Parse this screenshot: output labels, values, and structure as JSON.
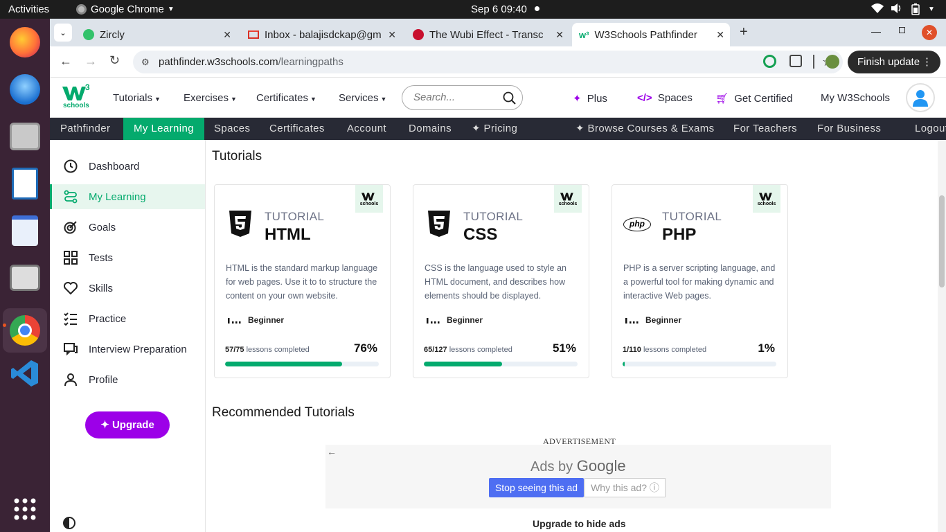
{
  "system": {
    "activities": "Activities",
    "app": "Google Chrome",
    "datetime": "Sep 6  09:40"
  },
  "browser": {
    "tabs": [
      {
        "title": "Zircly"
      },
      {
        "title": "Inbox - balajisdckap@gm"
      },
      {
        "title": "The Wubi Effect - Transc"
      },
      {
        "title": "W3Schools Pathfinder"
      }
    ],
    "url_host": "pathfinder.w3schools.com",
    "url_path": "/learningpaths",
    "finish_update": "Finish update"
  },
  "w3nav": {
    "logo_sup": "3",
    "logo_text": "schools",
    "tutorials": "Tutorials",
    "exercises": "Exercises",
    "certificates": "Certificates",
    "services": "Services",
    "search_placeholder": "Search...",
    "plus": "Plus",
    "spaces": "Spaces",
    "get_certified": "Get Certified",
    "my_w3schools": "My W3Schools"
  },
  "subnav": [
    "Pathfinder",
    "My Learning",
    "Spaces",
    "Certificates",
    "Account",
    "Domains",
    "Pricing",
    "Browse Courses & Exams",
    "For Teachers",
    "For Business",
    "Logout"
  ],
  "sidebar": {
    "items": [
      {
        "label": "Dashboard",
        "icon": "clock-icon"
      },
      {
        "label": "My Learning",
        "icon": "path-icon"
      },
      {
        "label": "Goals",
        "icon": "target-icon"
      },
      {
        "label": "Tests",
        "icon": "grid-icon"
      },
      {
        "label": "Skills",
        "icon": "heart-icon"
      },
      {
        "label": "Practice",
        "icon": "checklist-icon"
      },
      {
        "label": "Interview Preparation",
        "icon": "chat-icon"
      },
      {
        "label": "Profile",
        "icon": "person-icon"
      }
    ],
    "upgrade": "Upgrade"
  },
  "main": {
    "tutorials_heading": "Tutorials",
    "cards": [
      {
        "kind": "TUTORIAL",
        "name": "HTML",
        "desc": "HTML is the standard markup language for web pages. Use it to to structure the content on your own website.",
        "level": "Beginner",
        "done": "57/75",
        "lessons_text": "lessons completed",
        "percent": "76%",
        "progress": 0.76
      },
      {
        "kind": "TUTORIAL",
        "name": "CSS",
        "desc": "CSS is the language used to style an HTML document, and describes how elements should be displayed.",
        "level": "Beginner",
        "done": "65/127",
        "lessons_text": "lessons completed",
        "percent": "51%",
        "progress": 0.51
      },
      {
        "kind": "TUTORIAL",
        "name": "PHP",
        "desc": "PHP is a server scripting language, and a powerful tool for making dynamic and interactive Web pages.",
        "level": "Beginner",
        "done": "1/110",
        "lessons_text": "lessons completed",
        "percent": "1%",
        "progress": 0.01
      }
    ],
    "recommended_heading": "Recommended Tutorials",
    "ad_label": "ADVERTISEMENT",
    "ads_by": "Ads by",
    "ads_google": "Google",
    "stop_ad": "Stop seeing this ad",
    "why_ad": "Why this ad? ⓘ",
    "upgrade_hide": "Upgrade to hide ads"
  },
  "colors": {
    "accent": "#04aa6d",
    "nav_dark": "#282a35",
    "upgrade": "#9c00e8"
  }
}
